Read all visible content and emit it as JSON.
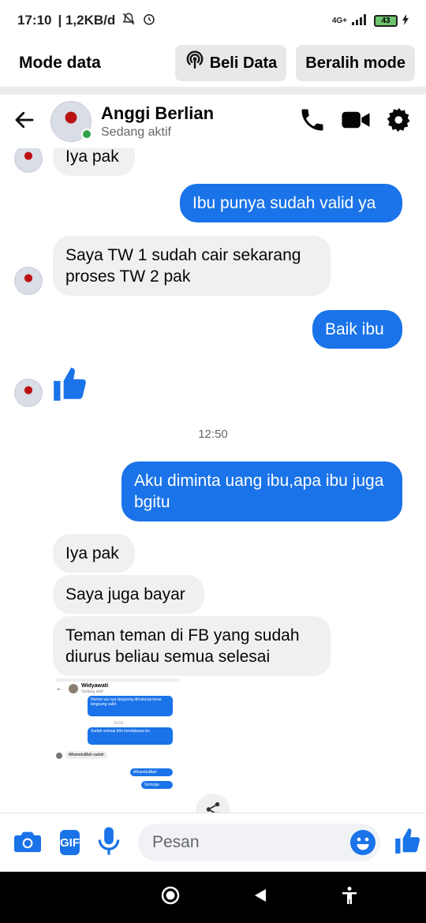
{
  "status_bar": {
    "time": "17:10",
    "network_speed": "1,2KB/d",
    "network_type": "4G+",
    "battery": "43"
  },
  "data_bar": {
    "title": "Mode data",
    "buy_data_label": "Beli Data",
    "switch_mode_label": "Beralih mode"
  },
  "chat_header": {
    "contact_name": "Anggi Berlian",
    "status": "Sedang aktif"
  },
  "messages": [
    {
      "side": "in",
      "text": "Iya pak"
    },
    {
      "side": "out",
      "text": "Ibu punya sudah valid ya"
    },
    {
      "side": "in",
      "text": "Saya TW 1 sudah cair sekarang proses TW 2 pak"
    },
    {
      "side": "out",
      "text": "Baik ibu"
    },
    {
      "side": "in",
      "type": "like"
    },
    {
      "type": "time",
      "text": "12:50"
    },
    {
      "side": "out",
      "text": "Aku diminta uang ibu,apa ibu juga bgitu"
    },
    {
      "side": "in",
      "text": "Iya pak"
    },
    {
      "side": "in",
      "text": "Saya juga bayar"
    },
    {
      "side": "in",
      "text": "Teman teman di FB yang sudah diurus beliau semua selesai"
    }
  ],
  "screenshot_attachment": {
    "contact_name": "Widyawati",
    "contact_status": "Sedang aktif",
    "bubble_1": "Nomor wa nya langsung dihubungi terus langsung valid",
    "time": "16:03",
    "bubble_2": "Sudah selesai blm kendalanya bu",
    "reply": "Alhamdulillah sudah",
    "bubble_3": "Alhamdulillah",
    "bubble_4": "Semoga"
  },
  "composer": {
    "placeholder": "Pesan",
    "gif_label": "GIF"
  },
  "colors": {
    "accent": "#1a73e8",
    "bubble_in": "#f0f0f0",
    "online": "#31a24c"
  }
}
